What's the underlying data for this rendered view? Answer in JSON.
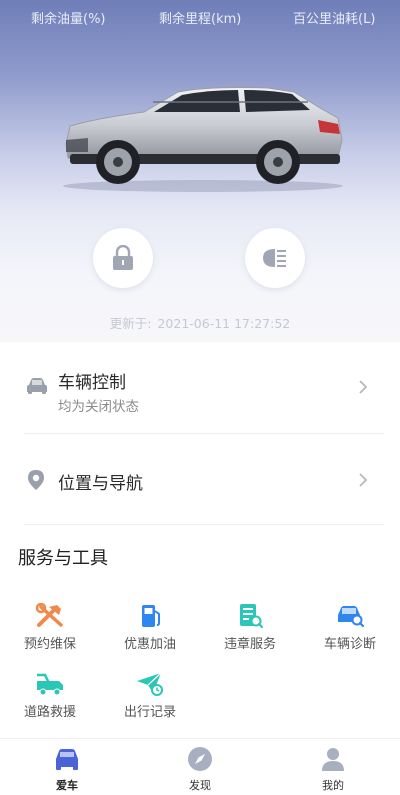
{
  "stats": {
    "fuel_label": "剩余油量(%)",
    "range_label": "剩余里程(km)",
    "consumption_label": "百公里油耗(L)"
  },
  "updated": {
    "prefix": "更新于:",
    "time": "2021-06-11 17:27:52"
  },
  "vehicle_control": {
    "title": "车辆控制",
    "subtitle": "均为关闭状态"
  },
  "navigation": {
    "title": "位置与导航"
  },
  "services": {
    "title": "服务与工具",
    "items": [
      {
        "label": "预约维保",
        "icon": "wrench-hammer-icon"
      },
      {
        "label": "优惠加油",
        "icon": "gas-pump-icon"
      },
      {
        "label": "违章服务",
        "icon": "document-search-icon"
      },
      {
        "label": "车辆诊断",
        "icon": "car-search-icon"
      },
      {
        "label": "道路救援",
        "icon": "tow-truck-icon"
      },
      {
        "label": "出行记录",
        "icon": "paper-plane-clock-icon"
      }
    ]
  },
  "tabs": [
    {
      "label": "爱车",
      "icon": "car-icon",
      "active": true
    },
    {
      "label": "发现",
      "icon": "compass-icon",
      "active": false
    },
    {
      "label": "我的",
      "icon": "person-icon",
      "active": false
    }
  ],
  "colors": {
    "accent_orange": "#f08a4b",
    "accent_blue": "#2f86f0",
    "accent_teal": "#2cc6b8",
    "icon_gray": "#8f96a3"
  }
}
